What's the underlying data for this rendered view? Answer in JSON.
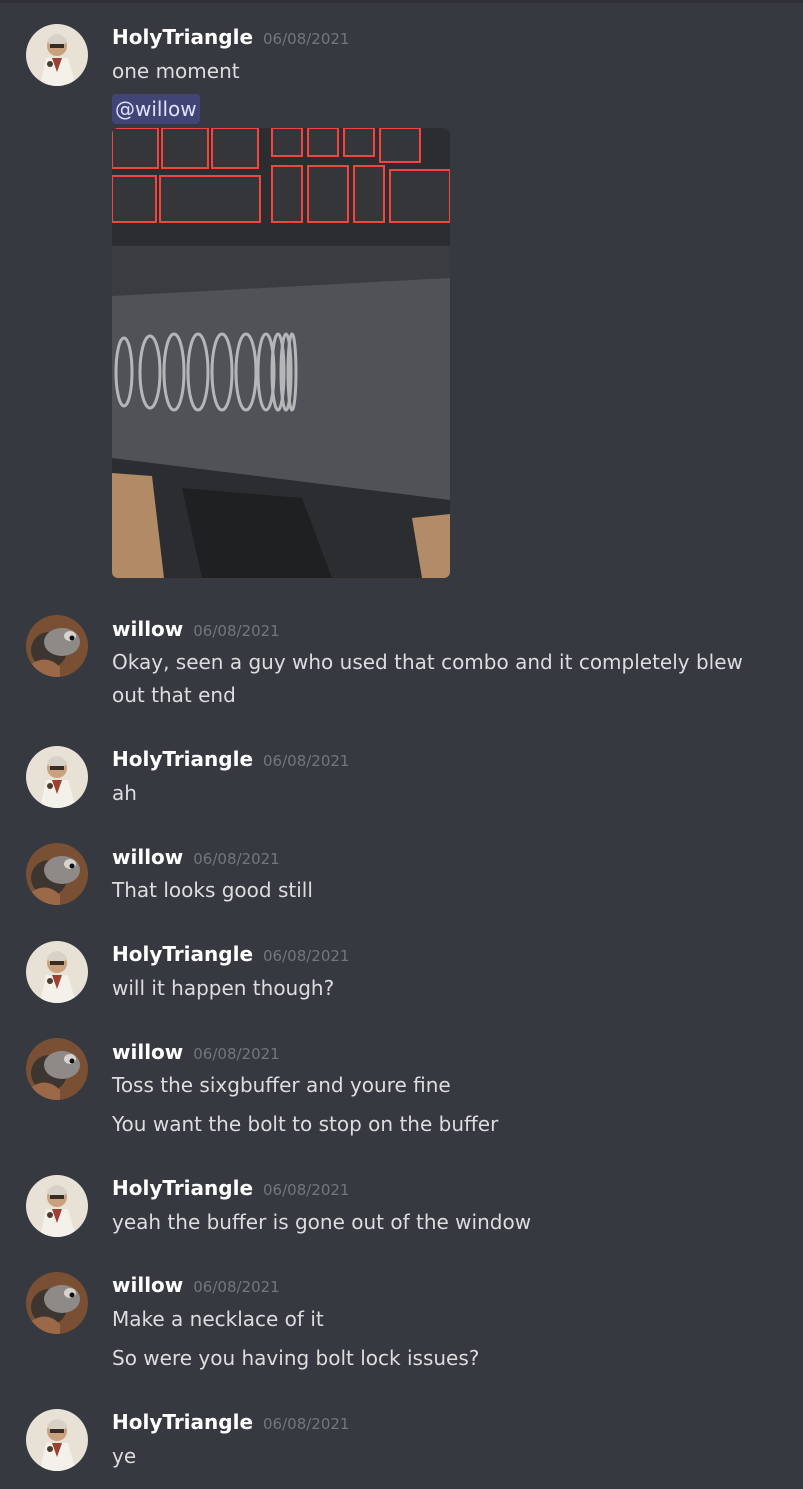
{
  "messages": [
    {
      "user": "HolyTriangle",
      "time": "06/08/2021",
      "lines": [
        "one moment"
      ],
      "mention": "@willow",
      "attachment_desc": "photo-attachment"
    },
    {
      "user": "willow",
      "time": "06/08/2021",
      "lines": [
        "Okay, seen a guy who used that combo and it completely blew",
        "out that end"
      ]
    },
    {
      "user": "HolyTriangle",
      "time": "06/08/2021",
      "lines": [
        "ah"
      ]
    },
    {
      "user": "willow",
      "time": "06/08/2021",
      "lines": [
        "That looks good still"
      ]
    },
    {
      "user": "HolyTriangle",
      "time": "06/08/2021",
      "lines": [
        "will it happen though?"
      ]
    },
    {
      "user": "willow",
      "time": "06/08/2021",
      "lines": [
        "Toss the sixgbuffer and youre fine",
        "You want the bolt to stop on the buffer"
      ]
    },
    {
      "user": "HolyTriangle",
      "time": "06/08/2021",
      "lines": [
        "yeah the buffer is gone out of the window"
      ]
    },
    {
      "user": "willow",
      "time": "06/08/2021",
      "lines": [
        "Make a necklace of it",
        "So were you having bolt lock issues?"
      ]
    },
    {
      "user": "HolyTriangle",
      "time": "06/08/2021",
      "lines": [
        "ye"
      ]
    }
  ],
  "colors": {
    "background": "#36393f",
    "username": "#ffffff",
    "timestamp": "#72767d",
    "text": "#dcddde",
    "mention_bg": "#414675",
    "mention_text": "#dee0fc"
  }
}
